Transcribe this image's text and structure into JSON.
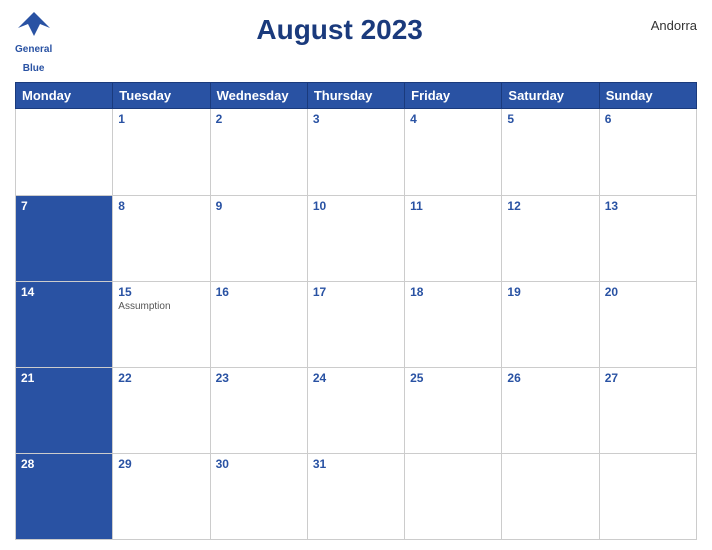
{
  "header": {
    "title": "August 2023",
    "country": "Andorra",
    "logo": {
      "line1": "General",
      "line2": "Blue"
    }
  },
  "weekdays": [
    "Monday",
    "Tuesday",
    "Wednesday",
    "Thursday",
    "Friday",
    "Saturday",
    "Sunday"
  ],
  "weeks": [
    [
      {
        "day": "",
        "events": []
      },
      {
        "day": "1",
        "events": []
      },
      {
        "day": "2",
        "events": []
      },
      {
        "day": "3",
        "events": []
      },
      {
        "day": "4",
        "events": []
      },
      {
        "day": "5",
        "events": []
      },
      {
        "day": "6",
        "events": []
      }
    ],
    [
      {
        "day": "7",
        "events": []
      },
      {
        "day": "8",
        "events": []
      },
      {
        "day": "9",
        "events": []
      },
      {
        "day": "10",
        "events": []
      },
      {
        "day": "11",
        "events": []
      },
      {
        "day": "12",
        "events": []
      },
      {
        "day": "13",
        "events": []
      }
    ],
    [
      {
        "day": "14",
        "events": []
      },
      {
        "day": "15",
        "events": [
          "Assumption"
        ]
      },
      {
        "day": "16",
        "events": []
      },
      {
        "day": "17",
        "events": []
      },
      {
        "day": "18",
        "events": []
      },
      {
        "day": "19",
        "events": []
      },
      {
        "day": "20",
        "events": []
      }
    ],
    [
      {
        "day": "21",
        "events": []
      },
      {
        "day": "22",
        "events": []
      },
      {
        "day": "23",
        "events": []
      },
      {
        "day": "24",
        "events": []
      },
      {
        "day": "25",
        "events": []
      },
      {
        "day": "26",
        "events": []
      },
      {
        "day": "27",
        "events": []
      }
    ],
    [
      {
        "day": "28",
        "events": []
      },
      {
        "day": "29",
        "events": []
      },
      {
        "day": "30",
        "events": []
      },
      {
        "day": "31",
        "events": []
      },
      {
        "day": "",
        "events": []
      },
      {
        "day": "",
        "events": []
      },
      {
        "day": "",
        "events": []
      }
    ]
  ]
}
